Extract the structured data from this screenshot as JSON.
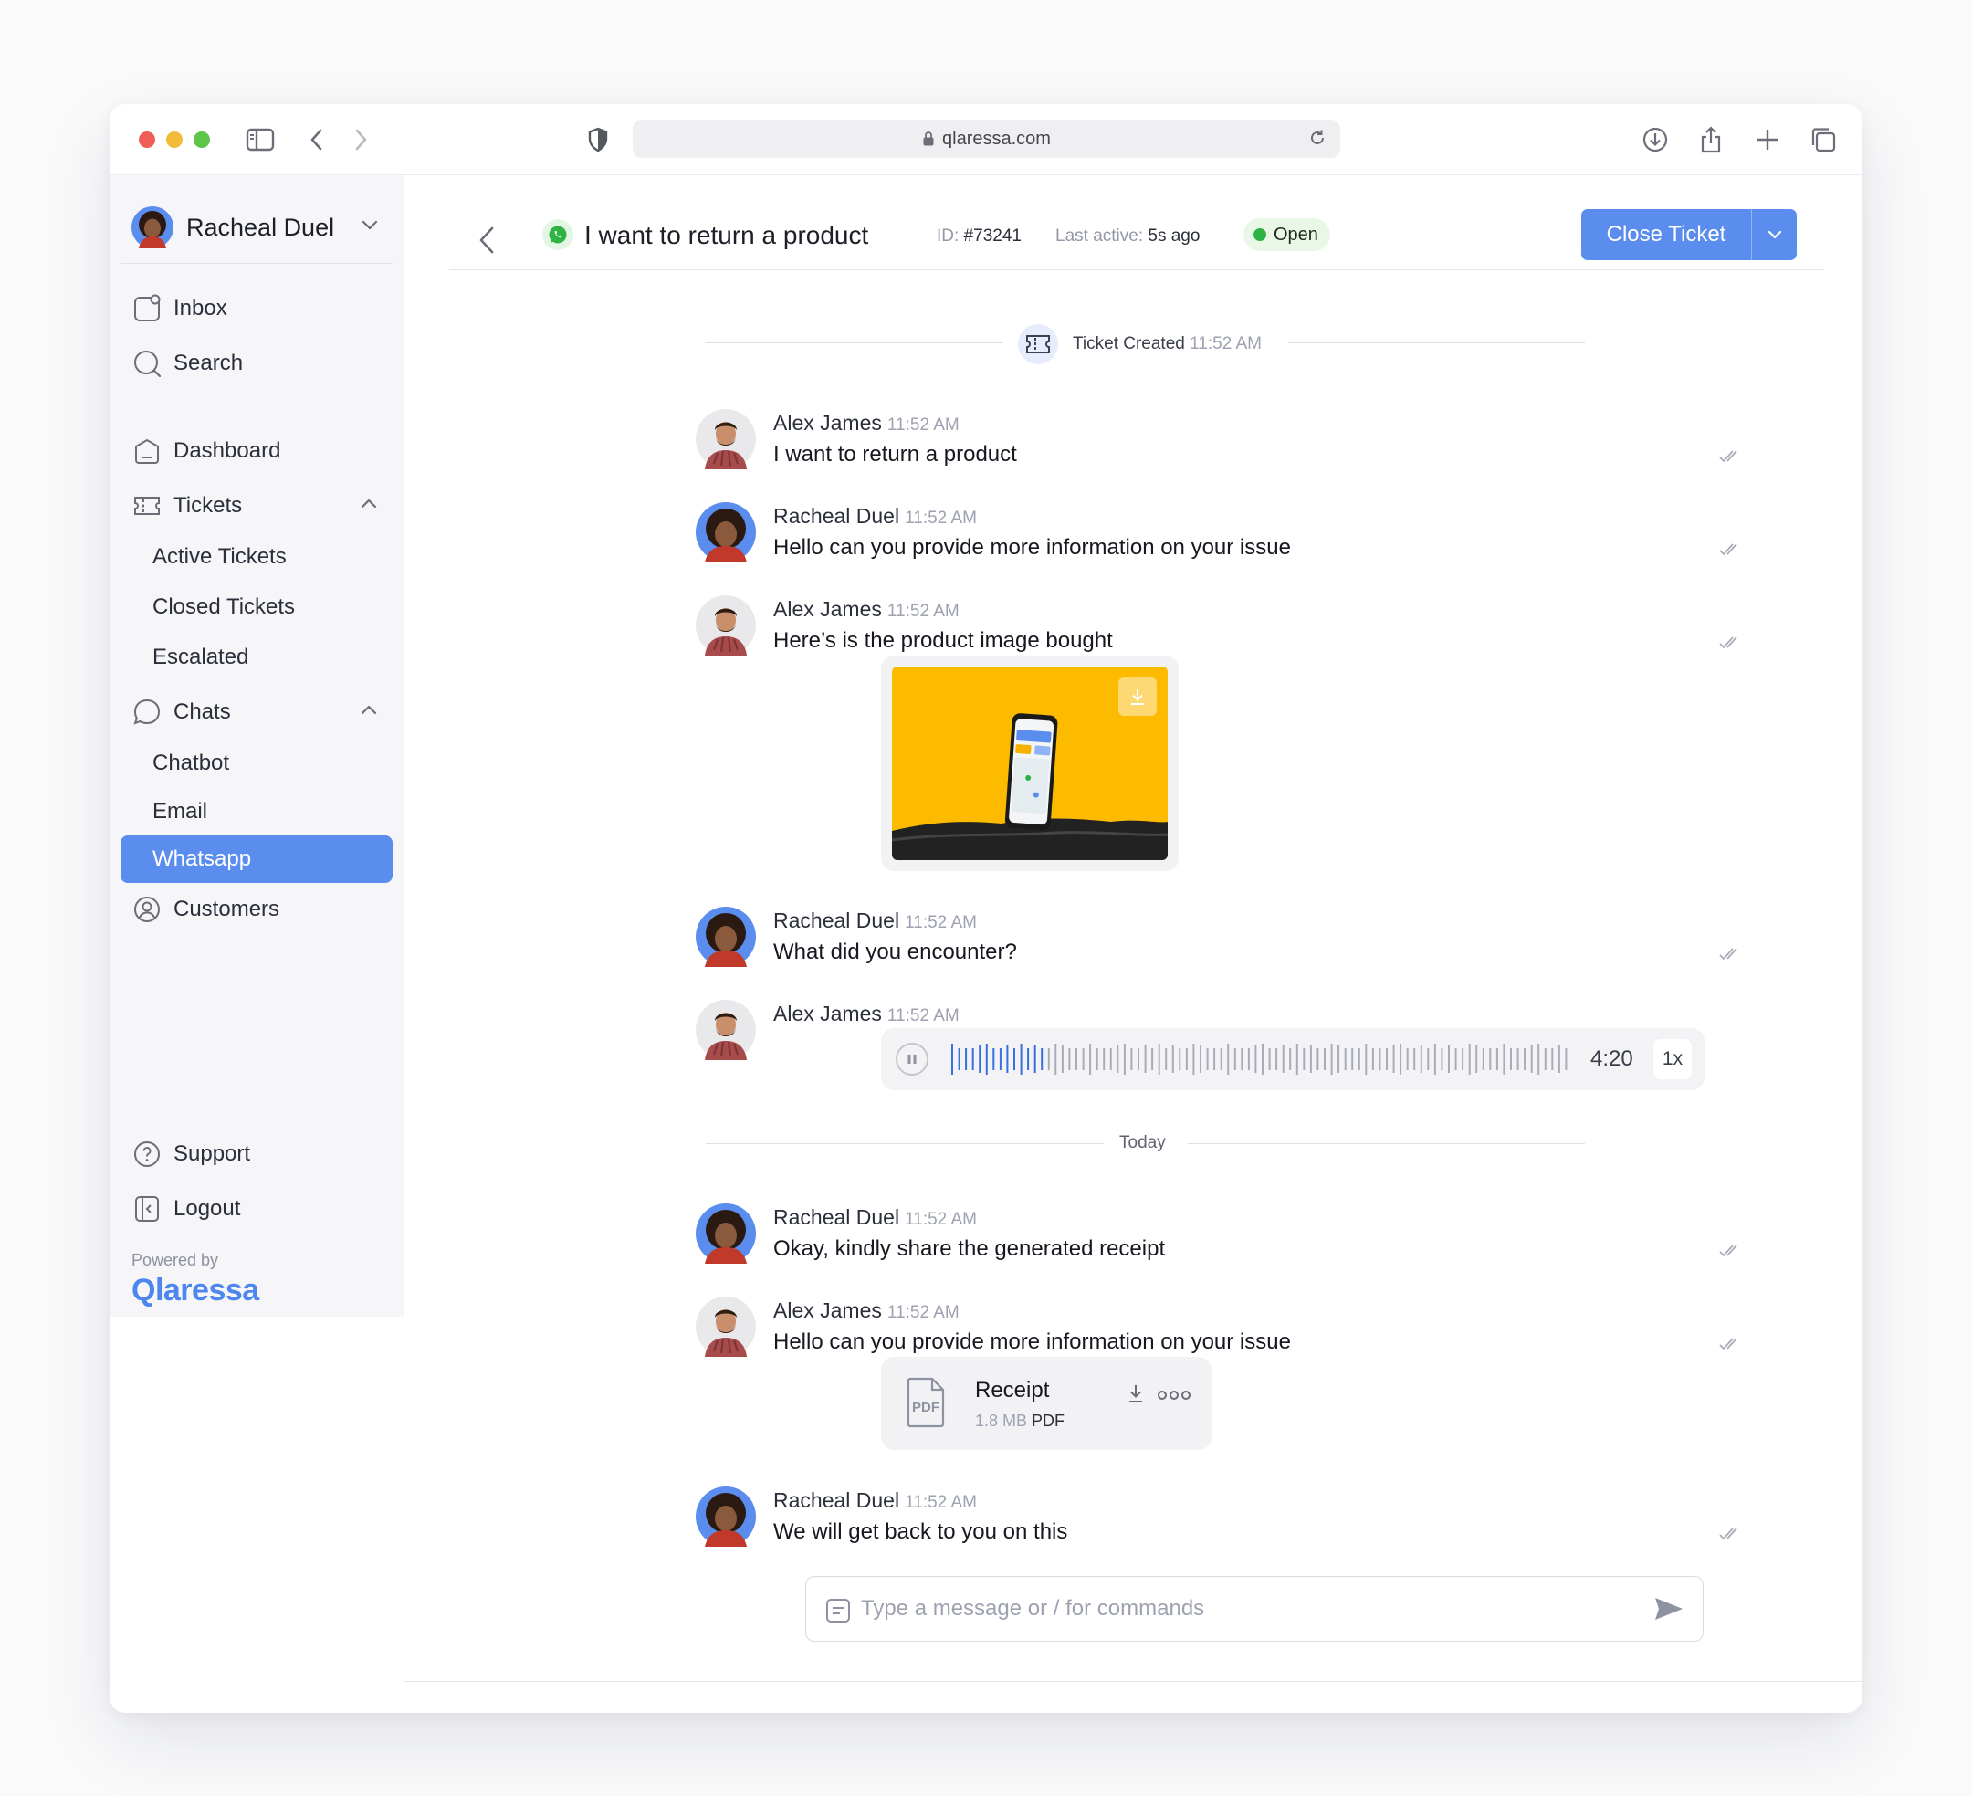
{
  "browser": {
    "url": "qlaressa.com"
  },
  "sidebar": {
    "user_name": "Racheal Duel",
    "nav": {
      "inbox": "Inbox",
      "search": "Search",
      "dashboard": "Dashboard",
      "tickets": "Tickets",
      "active_tickets": "Active Tickets",
      "closed_tickets": "Closed Tickets",
      "escalated": "Escalated",
      "chats": "Chats",
      "chatbot": "Chatbot",
      "email": "Email",
      "whatsapp": "Whatsapp",
      "customers": "Customers",
      "support": "Support",
      "logout": "Logout"
    },
    "powered_by": "Powered by",
    "brand": "Qlaressa"
  },
  "header": {
    "title": "I want to return a product",
    "id_label": "ID:",
    "id_value": "#73241",
    "last_active_label": "Last active:",
    "last_active_value": "5s ago",
    "status": "Open",
    "close_button": "Close Ticket"
  },
  "colors": {
    "accent": "#5b8def",
    "status_green": "#2fb344",
    "image_background": "#fdbb00"
  },
  "system_event": {
    "label": "Ticket Created",
    "time": "11:52 AM"
  },
  "day_separator": "Today",
  "messages": [
    {
      "sender": "Alex James",
      "time": "11:52 AM",
      "text": "I want to return a product"
    },
    {
      "sender": "Racheal Duel",
      "time": "11:52 AM",
      "text": "Hello can you provide more information on your issue"
    },
    {
      "sender": "Alex James",
      "time": "11:52 AM",
      "text": "Here’s is the product image bought"
    },
    {
      "sender": "Racheal Duel",
      "time": "11:52 AM",
      "text": "What did you encounter?"
    },
    {
      "sender": "Alex James",
      "time": "11:52 AM",
      "text": ""
    },
    {
      "sender": "Racheal Duel",
      "time": "11:52 AM",
      "text": "Okay, kindly share the generated receipt"
    },
    {
      "sender": "Alex James",
      "time": "11:52 AM",
      "text": "Hello can you provide more information on your issue"
    },
    {
      "sender": "Racheal Duel",
      "time": "11:52 AM",
      "text": "We will get back to you on this"
    }
  ],
  "voice_note": {
    "duration": "4:20",
    "speed": "1x",
    "progress": 0.16
  },
  "attachment": {
    "name": "Receipt",
    "size": "1.8 MB",
    "type": "PDF"
  },
  "composer": {
    "placeholder": "Type a message or / for commands"
  }
}
